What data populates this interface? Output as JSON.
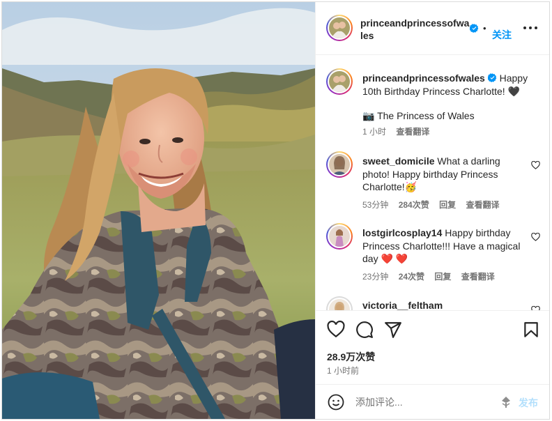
{
  "post": {
    "username": "princeandprincessofwales",
    "follow_label": "关注",
    "more_icon": "more-horizontal-icon",
    "verified_icon": "verified-badge-icon",
    "accent": "#0095f6"
  },
  "photo": {
    "description_icon": "post-photo",
    "colors": {
      "sky": "#c9d8e8",
      "grass": "#a7ae6a",
      "hills": "#7d7a4c",
      "hair": "#c99b5e"
    }
  },
  "comments": [
    {
      "username": "princeandprincessofwales",
      "verified": true,
      "text": "Happy 10th Birthday Princess Charlotte! 🖤",
      "credit": "📷 The Princess of Wales",
      "meta": {
        "time": "1 小时",
        "translate": "查看翻译"
      }
    },
    {
      "username": "sweet_domicile",
      "text": "What a darling photo! Happy birthday Princess Charlotte!🥳",
      "meta": {
        "time": "53分钟",
        "likes": "284次赞",
        "reply": "回复",
        "translate": "查看翻译"
      }
    },
    {
      "username": "lostgirlcosplay14",
      "text": "Happy birthday Princess Charlotte!!! Have a magical day ❤️ ❤️",
      "meta": {
        "time": "23分钟",
        "likes": "24次赞",
        "reply": "回复",
        "translate": "查看翻译"
      }
    },
    {
      "username": "victoria__feltham",
      "text": ""
    }
  ],
  "actions": {
    "icons": [
      "heart-icon",
      "comment-icon",
      "share-icon",
      "bookmark-icon"
    ],
    "likes": "28.9万次赞",
    "time": "1 小时前"
  },
  "add_comment": {
    "placeholder": "添加评论...",
    "post_label": "发布",
    "post_color": "#b2dffc"
  }
}
